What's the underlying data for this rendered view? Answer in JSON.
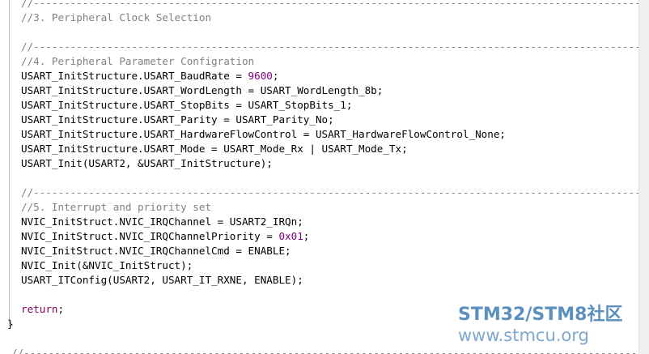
{
  "code": {
    "lines": [
      {
        "text": "//------------------------------------------------------------------------------------------------------------------------",
        "kind": "comment"
      },
      {
        "text": "//3. Peripheral Clock Selection",
        "kind": "comment"
      },
      {
        "text": "//------------------------------------------------------------------------------------------------------------------------",
        "kind": "comment"
      },
      {
        "text": "//4. Peripheral Parameter Configration",
        "kind": "comment"
      },
      {
        "text_pre": "USART_InitStructure.USART_BaudRate = ",
        "num": "9600",
        "text_post": ";",
        "kind": "code-num"
      },
      {
        "text": "USART_InitStructure.USART_WordLength = USART_WordLength_8b;",
        "kind": "code"
      },
      {
        "text": "USART_InitStructure.USART_StopBits = USART_StopBits_1;",
        "kind": "code"
      },
      {
        "text": "USART_InitStructure.USART_Parity = USART_Parity_No;",
        "kind": "code"
      },
      {
        "text": "USART_InitStructure.USART_HardwareFlowControl = USART_HardwareFlowControl_None;",
        "kind": "code"
      },
      {
        "text": "USART_InitStructure.USART_Mode = USART_Mode_Rx | USART_Mode_Tx;",
        "kind": "code"
      },
      {
        "text": "USART_Init(USART2, &USART_InitStructure);",
        "kind": "code"
      },
      {
        "text": "//------------------------------------------------------------------------------------------------------------------------",
        "kind": "comment"
      },
      {
        "text": "//5. Interrupt and priority set",
        "kind": "comment"
      },
      {
        "text": "NVIC_InitStruct.NVIC_IRQChannel = USART2_IRQn;",
        "kind": "code"
      },
      {
        "text_pre": "NVIC_InitStruct.NVIC_IRQChannelPriority = ",
        "num": "0x01",
        "text_post": ";",
        "kind": "code-num"
      },
      {
        "text": "NVIC_InitStruct.NVIC_IRQChannelCmd = ENABLE;",
        "kind": "code"
      },
      {
        "text": "NVIC_Init(&NVIC_InitStruct);",
        "kind": "code"
      },
      {
        "text": "USART_ITConfig(USART2, USART_IT_RXNE, ENABLE);",
        "kind": "code"
      },
      {
        "keyword": "return",
        "text_post": ";",
        "kind": "code-kw"
      },
      {
        "text": "}",
        "kind": "code"
      },
      {
        "text": "//------------------------------------------------------------------------------------------------------------------------",
        "kind": "comment"
      }
    ]
  },
  "watermark": {
    "logo": "STM32/STM8社区",
    "url": "www.stmcu.org"
  },
  "colors": {
    "comment": "#808080",
    "number": "#800080",
    "keyword": "#7f0055",
    "watermark": "#5b8fbf"
  }
}
